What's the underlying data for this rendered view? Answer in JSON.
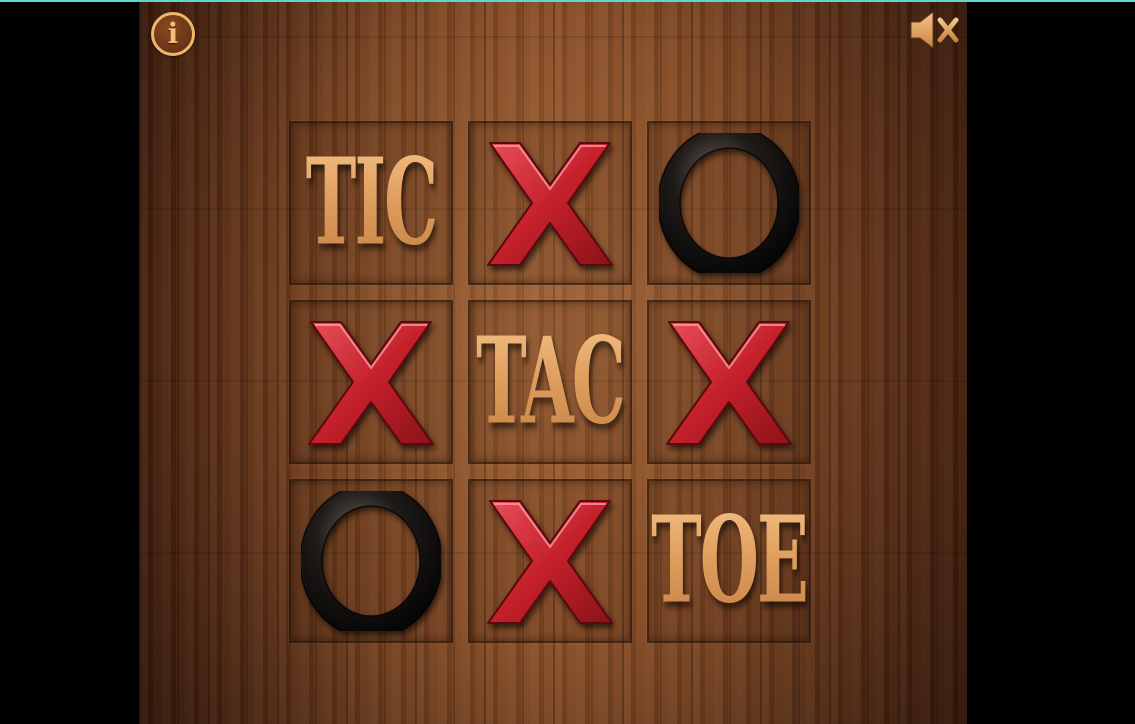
{
  "game": {
    "board": [
      [
        "TIC",
        "X",
        "O"
      ],
      [
        "X",
        "TAC",
        "X"
      ],
      [
        "O",
        "X",
        "TOE"
      ]
    ]
  },
  "icons": {
    "info": "info-icon",
    "info_glyph": "i",
    "sound": "speaker-muted-icon"
  },
  "colors": {
    "x_piece": "#c4202a",
    "o_piece": "#1e1a18",
    "word_tile": "#e3a465",
    "icon_accent": "#f0b46a"
  }
}
